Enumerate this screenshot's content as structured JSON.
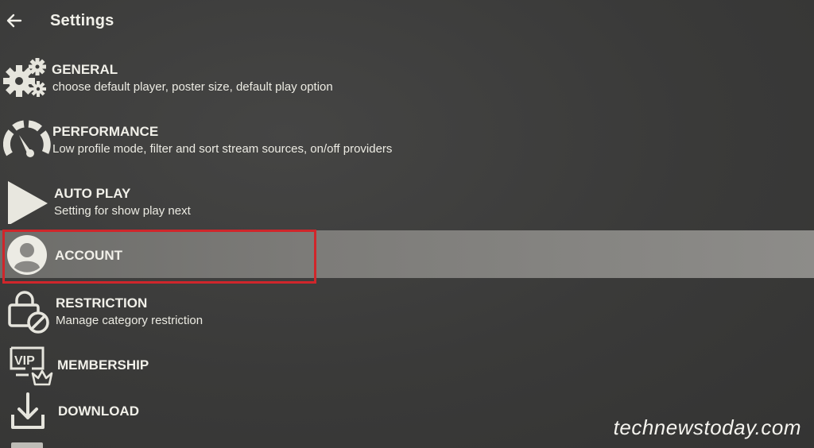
{
  "header": {
    "title": "Settings",
    "back_icon": "arrow-left-icon"
  },
  "menu": [
    {
      "title": "GENERAL",
      "subtitle": "choose default player, poster size, default play option",
      "icon": "gears-icon"
    },
    {
      "title": "PERFORMANCE",
      "subtitle": "Low profile mode, filter and sort stream sources, on/off providers",
      "icon": "speedometer-icon"
    },
    {
      "title": "AUTO PLAY",
      "subtitle": "Setting for show play next",
      "icon": "play-icon"
    },
    {
      "title": "ACCOUNT",
      "subtitle": "",
      "icon": "user-icon",
      "selected": true
    },
    {
      "title": "RESTRICTION",
      "subtitle": "Manage category restriction",
      "icon": "lock-restriction-icon"
    },
    {
      "title": "MEMBERSHIP",
      "subtitle": "",
      "icon": "vip-crown-icon"
    },
    {
      "title": "DOWNLOAD",
      "subtitle": "",
      "icon": "download-icon"
    }
  ],
  "watermark": "technewstoday.com",
  "colors": {
    "background": "#3b3b3a",
    "text": "#f1f0e9",
    "selected_row": "#7d7c79",
    "highlight_border": "#d0262b"
  }
}
